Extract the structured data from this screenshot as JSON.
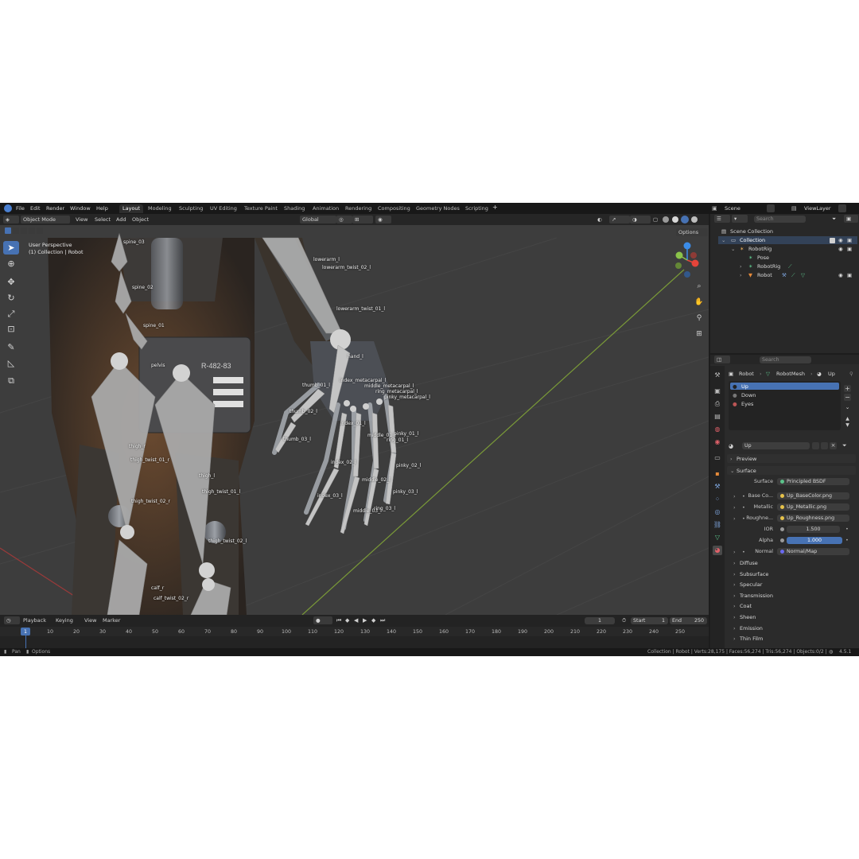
{
  "menubar": {
    "items": [
      "File",
      "Edit",
      "Render",
      "Window",
      "Help"
    ],
    "workspaces": [
      "Layout",
      "Modeling",
      "Sculpting",
      "UV Editing",
      "Texture Paint",
      "Shading",
      "Animation",
      "Rendering",
      "Compositing",
      "Geometry Nodes",
      "Scripting"
    ],
    "active_workspace": "Layout",
    "add_tab": "+",
    "scene": "Scene",
    "view_layer": "ViewLayer"
  },
  "viewport": {
    "mode": "Object Mode",
    "menus": [
      "View",
      "Select",
      "Add",
      "Object"
    ],
    "transform_orientation": "Global",
    "options_label": "Options",
    "overlay_title": "User Perspective",
    "overlay_subtitle": "(1) Collection | Robot",
    "panel_text": "R-482-83",
    "bones": [
      "spine_03",
      "spine_02",
      "spine_01",
      "pelvis",
      "thigh_r",
      "thigh_twist_01_r",
      "thigh_twist_02_r",
      "thigh_l",
      "thigh_twist_01_l",
      "thigh_twist_02_l",
      "calf_r",
      "calf_twist_02_r",
      "lowerarm_l",
      "lowerarm_twist_02_l",
      "lowerarm_twist_01_l",
      "hand_l",
      "thumb_01_l",
      "thumb_02_l",
      "thumb_03_l",
      "index_metacarpal_l",
      "middle_metacarpal_l",
      "ring_metacarpal_l",
      "pinky_metacarpal_l",
      "index_01_l",
      "middle_01_l",
      "ring_01_l",
      "pinky_01_l",
      "index_02_l",
      "pinky_02_l",
      "middle_02_l",
      "index_03_l",
      "pinky_03_l",
      "middle_03_l",
      "ring_03_l"
    ]
  },
  "outliner": {
    "search_placeholder": "Search",
    "scene_collection": "Scene Collection",
    "collection": "Collection",
    "items": [
      "RobotRig",
      "Pose",
      "RobotRig",
      "Robot"
    ]
  },
  "properties": {
    "search_placeholder": "Search",
    "breadcrumb": [
      "Robot",
      "RobotMesh",
      "Up"
    ],
    "materials": [
      "Up",
      "Down",
      "Eyes"
    ],
    "material_name": "Up",
    "sections": [
      "Preview",
      "Surface"
    ],
    "surface": {
      "surface_label": "Surface",
      "surface_value": "Principled BSDF",
      "base_color_label": "Base Co...",
      "base_color_value": "Up_BaseColor.png",
      "metallic_label": "Metallic",
      "metallic_value": "Up_Metallic.png",
      "roughness_label": "Roughne...",
      "roughness_value": "Up_Roughness.png",
      "ior_label": "IOR",
      "ior_value": "1.500",
      "alpha_label": "Alpha",
      "alpha_value": "1.000",
      "normal_label": "Normal",
      "normal_value": "Normal/Map"
    },
    "subpanels": [
      "Diffuse",
      "Subsurface",
      "Specular",
      "Transmission",
      "Coat",
      "Sheen",
      "Emission",
      "Thin Film"
    ]
  },
  "timeline": {
    "menus": [
      "Playback",
      "Keying",
      "View",
      "Marker"
    ],
    "current_frame": "1",
    "start_label": "Start",
    "start_value": "1",
    "end_label": "End",
    "end_value": "250",
    "ticks": [
      "1",
      "10",
      "20",
      "30",
      "40",
      "50",
      "60",
      "70",
      "80",
      "90",
      "100",
      "110",
      "120",
      "130",
      "140",
      "150",
      "160",
      "170",
      "180",
      "190",
      "200",
      "210",
      "220",
      "230",
      "240",
      "250"
    ]
  },
  "statusbar": {
    "left": [
      "Pan",
      "Options"
    ],
    "stats": "Collection | Robot | Verts:28,175 | Faces:56,274 | Tris:56,274 | Objects:0/2 |",
    "version": "4.5.1"
  },
  "colors": {
    "accent": "#4772b3",
    "x_axis": "#e5443a",
    "y_axis": "#8bc34a",
    "z_axis": "#3b8ce8"
  }
}
